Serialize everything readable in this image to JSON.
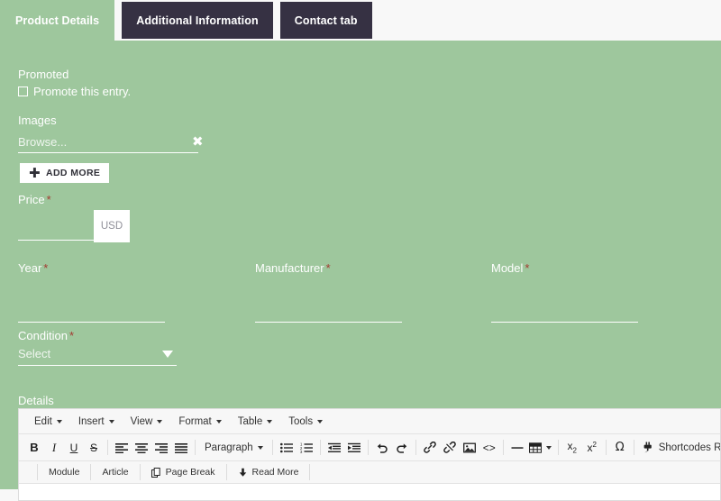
{
  "theme": {
    "form_bg": "#9ec79d",
    "tab_inactive_bg": "#363143",
    "page_bg": "#f8f8f8",
    "required_color": "#a33b32",
    "label_color": "#ffffff"
  },
  "tabs": [
    {
      "label": "Product Details",
      "active": true
    },
    {
      "label": "Additional Information",
      "active": false
    },
    {
      "label": "Contact tab",
      "active": false
    }
  ],
  "form": {
    "promoted": {
      "label": "Promoted",
      "checkbox_label": "Promote this entry.",
      "checked": false
    },
    "images": {
      "label": "Images",
      "browse_placeholder": "Browse...",
      "browse_value": "",
      "remove_icon": "✖",
      "add_more_label": "ADD MORE",
      "add_more_icon": "✚"
    },
    "price": {
      "label": "Price",
      "required": "*",
      "value": "",
      "currency": "USD"
    },
    "year": {
      "label": "Year",
      "required": "*",
      "value": ""
    },
    "manufacturer": {
      "label": "Manufacturer",
      "required": "*",
      "value": ""
    },
    "model": {
      "label": "Model",
      "required": "*",
      "value": ""
    },
    "condition": {
      "label": "Condition",
      "required": "*",
      "selected": "Select",
      "options": [
        "Select"
      ]
    },
    "details": {
      "label": "Details"
    }
  },
  "editor": {
    "menubar": [
      {
        "label": "Edit"
      },
      {
        "label": "Insert"
      },
      {
        "label": "View"
      },
      {
        "label": "Format"
      },
      {
        "label": "Table"
      },
      {
        "label": "Tools"
      }
    ],
    "format_select": {
      "value": "Paragraph"
    },
    "plugin_label": "Shortcodes RSTempl",
    "toolbar_icons": [
      "bold-icon",
      "italic-icon",
      "underline-icon",
      "strikethrough-icon",
      "align-left-icon",
      "align-center-icon",
      "align-right-icon",
      "align-justify-icon",
      "bullet-list-icon",
      "numbered-list-icon",
      "outdent-icon",
      "indent-icon",
      "undo-icon",
      "redo-icon",
      "link-icon",
      "unlink-icon",
      "image-icon",
      "source-code-icon",
      "horizontal-rule-icon",
      "table-icon",
      "subscript-icon",
      "superscript-icon",
      "special-character-icon",
      "plugin-icon"
    ],
    "joomla_buttons": [
      {
        "label": "Module",
        "icon": ""
      },
      {
        "label": "Article",
        "icon": ""
      },
      {
        "label": "Page Break",
        "icon": "page-break-icon"
      },
      {
        "label": "Read More",
        "icon": "read-more-icon"
      }
    ]
  }
}
